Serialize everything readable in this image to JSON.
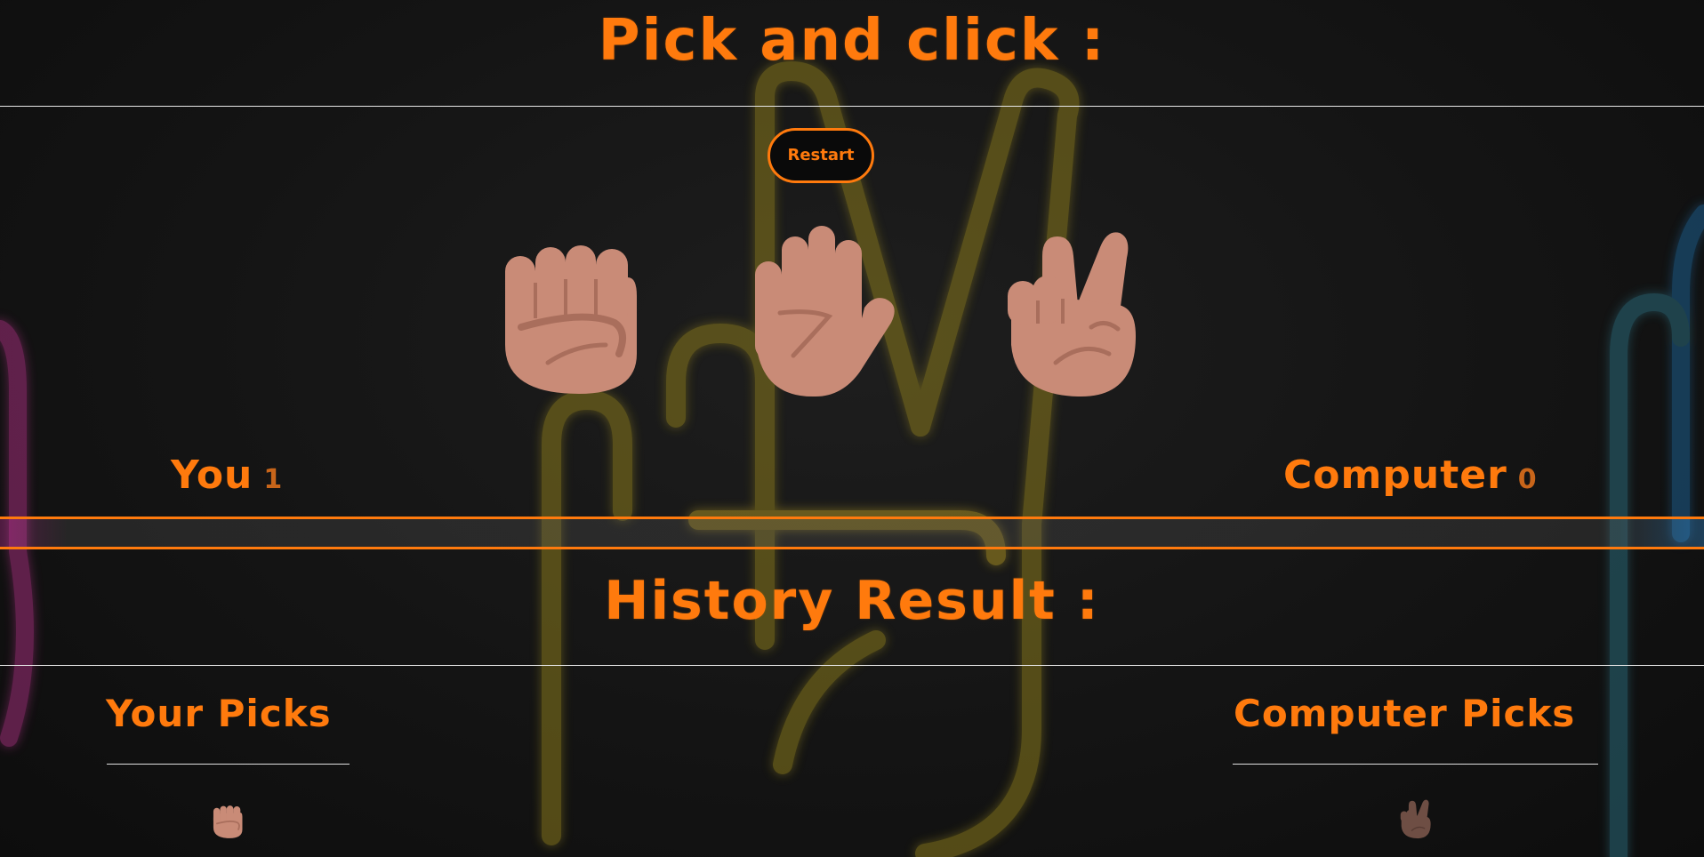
{
  "game": {
    "title": "Pick and click :",
    "restart_label": "Restart",
    "choices": [
      {
        "name": "rock",
        "icon": "fist-icon"
      },
      {
        "name": "paper",
        "icon": "open-hand-icon"
      },
      {
        "name": "scissors",
        "icon": "victory-hand-icon"
      }
    ],
    "score": {
      "you_label": "You",
      "you_value": "1",
      "computer_label": "Computer",
      "computer_value": "0"
    }
  },
  "history": {
    "title": "History Result :",
    "your_picks_title": "Your Picks",
    "computer_picks_title": "Computer Picks",
    "your_picks": [
      "fist-icon"
    ],
    "computer_picks": [
      "victory-hand-icon"
    ]
  },
  "colors": {
    "accent": "#ff7a0d",
    "background": "#121212",
    "skin": "#c98b77",
    "skin_dark": "#6e4e44"
  }
}
